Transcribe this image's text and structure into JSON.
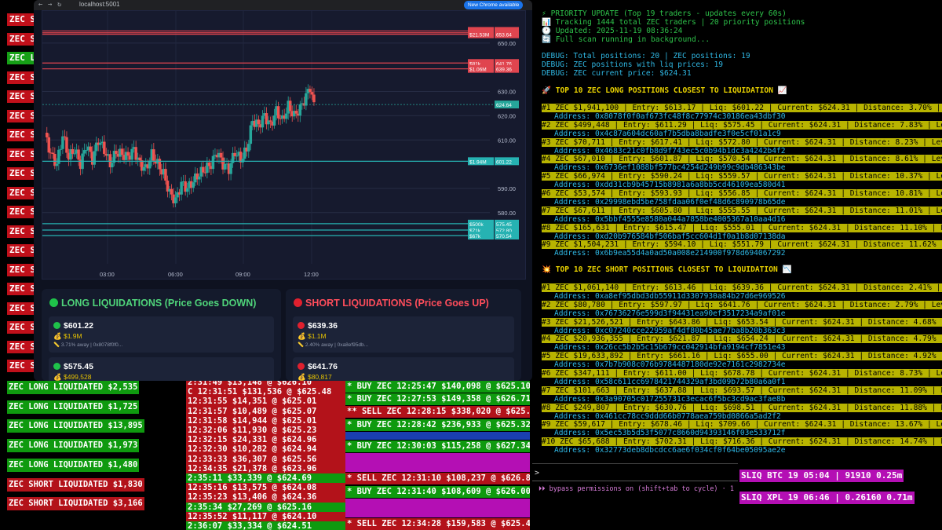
{
  "left_strip": [
    {
      "text": "ZEC SH",
      "bg": "#c0101a"
    },
    {
      "text": "ZEC SH",
      "bg": "#c0101a"
    },
    {
      "text": "ZEC LO",
      "bg": "#16a016"
    },
    {
      "text": "ZEC SH",
      "bg": "#c0101a"
    },
    {
      "text": "ZEC SH",
      "bg": "#c0101a"
    },
    {
      "text": "ZEC SH",
      "bg": "#c0101a"
    },
    {
      "text": "ZEC SH",
      "bg": "#c0101a"
    },
    {
      "text": "ZEC SH",
      "bg": "#c0101a"
    },
    {
      "text": "ZEC SH",
      "bg": "#c0101a"
    },
    {
      "text": "ZEC SH",
      "bg": "#c0101a"
    },
    {
      "text": "ZEC SH",
      "bg": "#c0101a"
    },
    {
      "text": "ZEC SH",
      "bg": "#c0101a"
    },
    {
      "text": "ZEC SH",
      "bg": "#c0101a"
    },
    {
      "text": "ZEC SH",
      "bg": "#c0101a"
    },
    {
      "text": "ZEC SH",
      "bg": "#c0101a"
    },
    {
      "text": "ZEC SH",
      "bg": "#c0101a"
    },
    {
      "text": "ZEC SH",
      "bg": "#c0101a"
    },
    {
      "text": "ZEC SH",
      "bg": "#c0101a"
    },
    {
      "text": "ZEC SH",
      "bg": "#c0101a"
    }
  ],
  "browser": {
    "url": "localhost:5001",
    "update_label": "New Chrome available"
  },
  "chart": {
    "price_ticks": [
      {
        "label": "650.00",
        "v": 650
      },
      {
        "label": "630.00",
        "v": 630
      },
      {
        "label": "620.00",
        "v": 620
      },
      {
        "label": "610.00",
        "v": 610
      },
      {
        "label": "590.00",
        "v": 590
      },
      {
        "label": "580.00",
        "v": 580
      }
    ],
    "time_ticks": [
      "03:00",
      "06:00",
      "09:00",
      "12:00"
    ],
    "current": {
      "label": "624.64",
      "v": 624.64
    },
    "levels": [
      {
        "size": "$19.6M",
        "price": "655.00",
        "v": 655.0,
        "side": "short"
      },
      {
        "size": "$20.95M",
        "price": "654.24",
        "v": 654.24,
        "side": "short"
      },
      {
        "size": "$21.53M",
        "price": "653.64",
        "v": 653.64,
        "side": "short"
      },
      {
        "size": "$81k",
        "price": "641.76",
        "v": 641.76,
        "side": "short"
      },
      {
        "size": "$1.06M",
        "price": "639.36",
        "v": 639.36,
        "side": "short"
      },
      {
        "size": "$1.94M",
        "price": "601.22",
        "v": 601.22,
        "side": "long"
      },
      {
        "size": "$500k",
        "price": "575.45",
        "v": 575.45,
        "side": "long"
      },
      {
        "size": "$71k",
        "price": "572.80",
        "v": 572.8,
        "side": "long"
      },
      {
        "size": "$67k",
        "price": "570.54",
        "v": 570.54,
        "side": "long"
      }
    ]
  },
  "long_panel": {
    "title": "LONG LIQUIDATIONS (Price Goes DOWN)",
    "cards": [
      {
        "price": "$601.22",
        "amount": "$1.9M",
        "detail": "3.71% away | 0x8078f0f0..."
      },
      {
        "price": "$575.45",
        "amount": "$499,528",
        "detail": ""
      }
    ]
  },
  "short_panel": {
    "title": "SHORT LIQUIDATIONS (Price Goes UP)",
    "cards": [
      {
        "price": "$639.36",
        "amount": "$1.1M",
        "detail": "2.40% away | 0xa8ef95db..."
      },
      {
        "price": "$641.76",
        "amount": "$80,817",
        "detail": ""
      }
    ]
  },
  "liq_feed": [
    {
      "text": "ZEC LONG LIQUIDATED $2,535",
      "bg": "#0f9a0f"
    },
    {
      "text": "ZEC LONG LIQUIDATED $1,725",
      "bg": "#0f9a0f"
    },
    {
      "text": "ZEC LONG LIQUIDATED $13,895",
      "bg": "#0f9a0f"
    },
    {
      "text": "ZEC LONG LIQUIDATED $1,973",
      "bg": "#0f9a0f"
    },
    {
      "text": "ZEC LONG LIQUIDATED $1,480",
      "bg": "#0f9a0f"
    },
    {
      "text": "ZEC SHORT LIQUIDATED $1,830",
      "bg": "#b3121a"
    },
    {
      "text": "ZEC SHORT LIQUIDATED $3,166",
      "bg": "#b3121a"
    }
  ],
  "trade_feed": [
    {
      "text": "2:31:49 $13,148 @ $626.10",
      "bg": "#b3121a"
    },
    {
      "text": "C 12:31:51 $131,536 @ $625.48",
      "bg": "#b3121a"
    },
    {
      "text": "12:31:55 $14,351 @ $625.01",
      "bg": "#b3121a"
    },
    {
      "text": "12:31:57 $10,489 @ $625.07",
      "bg": "#b3121a"
    },
    {
      "text": "12:31:58 $14,944 @ $625.01",
      "bg": "#b3121a"
    },
    {
      "text": "12:32:06 $11,930 @ $625.23",
      "bg": "#b3121a"
    },
    {
      "text": "12:32:15 $24,331 @ $624.96",
      "bg": "#b3121a"
    },
    {
      "text": "12:32:30 $10,282 @ $624.94",
      "bg": "#b3121a"
    },
    {
      "text": "12:33:33 $36,307 @ $625.56",
      "bg": "#b3121a"
    },
    {
      "text": "12:34:35 $21,378 @ $623.96",
      "bg": "#b3121a"
    },
    {
      "text": "2:35:11 $33,339 @ $624.69",
      "bg": "#0f9a0f"
    },
    {
      "text": "12:35:16 $13,575 @ $624.08",
      "bg": "#b3121a"
    },
    {
      "text": "12:35:23 $13,406 @ $624.36",
      "bg": "#b3121a"
    },
    {
      "text": "2:35:34 $27,269 @ $625.16",
      "bg": "#0f9a0f"
    },
    {
      "text": "12:35:52 $11,117 @ $624.10",
      "bg": "#b3121a"
    },
    {
      "text": "2:36:07 $33,334 @ $624.51",
      "bg": "#0f9a0f"
    }
  ],
  "whale_feed": [
    {
      "text": "* BUY ZEC 12:25:47 $140,098 @ $625.10",
      "bg": "#0f9a0f",
      "h": 15
    },
    {
      "text": "* BUY ZEC 12:27:53 $149,358 @ $626.71",
      "bg": "#0f9a0f",
      "h": 15
    },
    {
      "text": "** SELL ZEC 12:28:15 $338,020 @ $625.",
      "bg": "#b3121a",
      "h": 15
    },
    {
      "text": "* BUY ZEC 12:28:42 $236,933 @ $625.32",
      "bg": "#0f9a0f",
      "h": 15
    },
    {
      "text": "",
      "bg": "#1a3fb0",
      "h": 10
    },
    {
      "text": "* BUY ZEC 12:30:03 $115,258 @ $627.34",
      "bg": "#0f9a0f",
      "h": 15
    },
    {
      "text": "",
      "bg": "#b40fb4",
      "h": 24
    },
    {
      "text": "* SELL ZEC 12:31:10 $108,237 @ $626.8",
      "bg": "#b3121a",
      "h": 15
    },
    {
      "text": "* BUY ZEC 12:31:40 $108,609 @ $626.00",
      "bg": "#0f9a0f",
      "h": 15
    },
    {
      "text": "",
      "bg": "#b40fb4",
      "h": 24
    },
    {
      "text": "* SELL ZEC 12:34:28 $159,583 @ $625.4",
      "bg": "#b3121a",
      "h": 15
    },
    {
      "text": "** BUY ZEC 12:35:30 $497,305 @ $624.0",
      "bg": "#0f9a0f",
      "h": 15
    }
  ],
  "terminal": {
    "header": [
      {
        "icon": "⚡",
        "text": "PRIORITY UPDATE (Top 19 traders - updates every 60s)",
        "color": "#2ec24a"
      },
      {
        "icon": "📊",
        "text": "Tracking 1444 total ZEC traders | 20 priority positions",
        "color": "#2ec24a"
      },
      {
        "icon": "🕐",
        "text": "Updated: 2025-11-19 08:36:24",
        "color": "#2ec24a"
      },
      {
        "icon": "🔄",
        "text": "Full scan running in background...",
        "color": "#2ec24a"
      }
    ],
    "debug": [
      "DEBUG: Total positions: 20 | ZEC positions: 19",
      "DEBUG: ZEC positions with liq prices: 19",
      "DEBUG: ZEC current price: $624.31"
    ],
    "long_title": "🚀 TOP 10 ZEC LONG POSITIONS CLOSEST TO LIQUIDATION 📈",
    "long_rows": [
      {
        "text": "#1 ZEC $1,941,100 | Entry: $613.17 | Liq: $601.22 | Current: $624.31 | Distance: 3.70% | Leverage",
        "addr": "Address: 0x8078f0f0af673fc48f8c77974c30186ea43dbf30"
      },
      {
        "text": "#2 ZEC $499,448 | Entry: $611.29 | Liq: $575.45 | Current: $624.31 | Distance: 7.83% | Leverage",
        "addr": "Address: 0x4c87a604dc60af7b5dba8badfe3f0e5cf01a1c9"
      },
      {
        "text": "#3 ZEC $70,711 | Entry: $617.41 | Liq: $572.80 | Current: $624.31 | Distance: 8.23% | Leverage",
        "addr": "Address: 0x4683c21c0fb8d9f743ec5c0b94b1dc3a4242b4f2"
      },
      {
        "text": "#4 ZEC $67,010 | Entry: $601.87 | Liq: $570.54 | Current: $624.31 | Distance: 8.61% | Leverage",
        "addr": "Address: 0x6736ef1088bf577bc4254d249b99c9db486343be"
      },
      {
        "text": "#5 ZEC $66,974 | Entry: $590.24 | Liq: $559.57 | Current: $624.31 | Distance: 10.37% | Leverage",
        "addr": "Address: 0xdd31cb9b45715b8981a6a8bb5cd46109ea580d41"
      },
      {
        "text": "#6 ZEC $53,574 | Entry: $593.93 | Liq: $556.85 | Current: $624.31 | Distance: 10.81% | Leverage",
        "addr": "Address: 0x29998ebd5be758fdaa06f0ef48d6c890978b65de"
      },
      {
        "text": "#7 ZEC $67,611 | Entry: $605.80 | Liq: $555.55 | Current: $624.31 | Distance: 11.01% | Leverage",
        "addr": "Address: 0x5bbf4555e8580a044a7858be4005367a10aa4d16"
      },
      {
        "text": "#8 ZEC $165,631 | Entry: $615.47 | Liq: $555.01 | Current: $624.31 | Distance: 11.10% | Leverage",
        "addr": "Address: 0xd20b976584bf506baf5cc604d1f0a1b8d07138da"
      },
      {
        "text": "#9 ZEC $1,504,231 | Entry: $594.10 | Liq: $551.79 | Current: $624.31 | Distance: 11.62% | Leverage",
        "addr": "Address: 0x6b9ea55d4a0ad50a008e214900f978d694067292"
      }
    ],
    "short_title": "💥 TOP 10 ZEC SHORT POSITIONS CLOSEST TO LIQUIDATION 📉",
    "short_rows": [
      {
        "text": "#1 ZEC $1,061,140 | Entry: $613.46 | Liq: $639.36 | Current: $624.31 | Distance: 2.41% | Leve",
        "addr": "Address: 0xa8ef95dbd3db55911d3307930a84b27d6e969526"
      },
      {
        "text": "#2 ZEC $80,780 | Entry: $597.97 | Liq: $641.76 | Current: $624.31 | Distance: 2.79% | Leverage",
        "addr": "Address: 0x76736276e599d3f94431ea90ef3517234a9af01e"
      },
      {
        "text": "#3 ZEC $21,526,521 | Entry: $643.86 | Liq: $653.54 | Current: $624.31 | Distance: 4.68% | Leve",
        "addr": "Address: 0xc07240cce22959af4df80b45ae77ba8b20b363c3"
      },
      {
        "text": "#4 ZEC $20,936,355 | Entry: $621.87 | Liq: $654.24 | Current: $624.31 | Distance: 4.79% | Leve",
        "addr": "Address: 0x26cc5b2b5c15b679cc042914bfa9194cf7851e43"
      },
      {
        "text": "#5 ZEC $19,633,892 | Entry: $661.16 | Liq: $655.00 | Current: $624.31 | Distance: 4.92% | Leve",
        "addr": "Address: 0x7b7b908c076b9784487180de92e7161c2982734e"
      },
      {
        "text": "#6 ZEC $347,111 | Entry: $611.00 | Liq: $678.78 | Current: $624.31 | Distance: 8.73% | Leverage",
        "addr": "Address: 0x58c611cc6978421744329af3bd09b72b80a6a0f1"
      },
      {
        "text": "#7 ZEC $101,663 | Entry: $637.88 | Liq: $693.57 | Current: $624.31 | Distance: 11.09% | Leverage",
        "addr": "Address: 0x3a90705c017255731c3ecac6f5bc3cd9ac3fae8b"
      },
      {
        "text": "#8 ZEC $249,807 | Entry: $630.76 | Liq: $698.51 | Current: $624.31 | Distance: 11.88% | Leverage",
        "addr": "Address: 0x461cc78cc9ddd66b0778aea759bd0866a5ad2f2"
      },
      {
        "text": "#9 ZEC $59,617 | Entry: $678.46 | Liq: $709.66 | Current: $624.31 | Distance: 13.67% | Leverage",
        "addr": "Address: 0x5ec53b5d53f5077c8660d94393146f03e533712f"
      },
      {
        "text": "#10 ZEC $65,688 | Entry: $702.31 | Liq: $716.36 | Current: $624.31 | Distance: 14.74% | Leverage",
        "addr": "Address: 0x32773deb8dbcdcc6ae6f034cf0f64be05095ae2e"
      }
    ]
  },
  "cli": {
    "prompt": ">",
    "hint": "⏵⏵ bypass permissions on (shift+tab to cycle) · 1 backgr"
  },
  "sliq": [
    {
      "text": "SLIQ BTC 19 05:04 | 91910 0.25m"
    },
    {
      "text": "SLIQ XPL 19 06:46 | 0.26160 0.71m"
    }
  ],
  "colors": {
    "long_bg": "#b8b400",
    "short_bg": "#b8b400",
    "up": "#26a69a",
    "down": "#ef5350",
    "short_line": "#e0454f",
    "long_line": "#26b2b2"
  }
}
